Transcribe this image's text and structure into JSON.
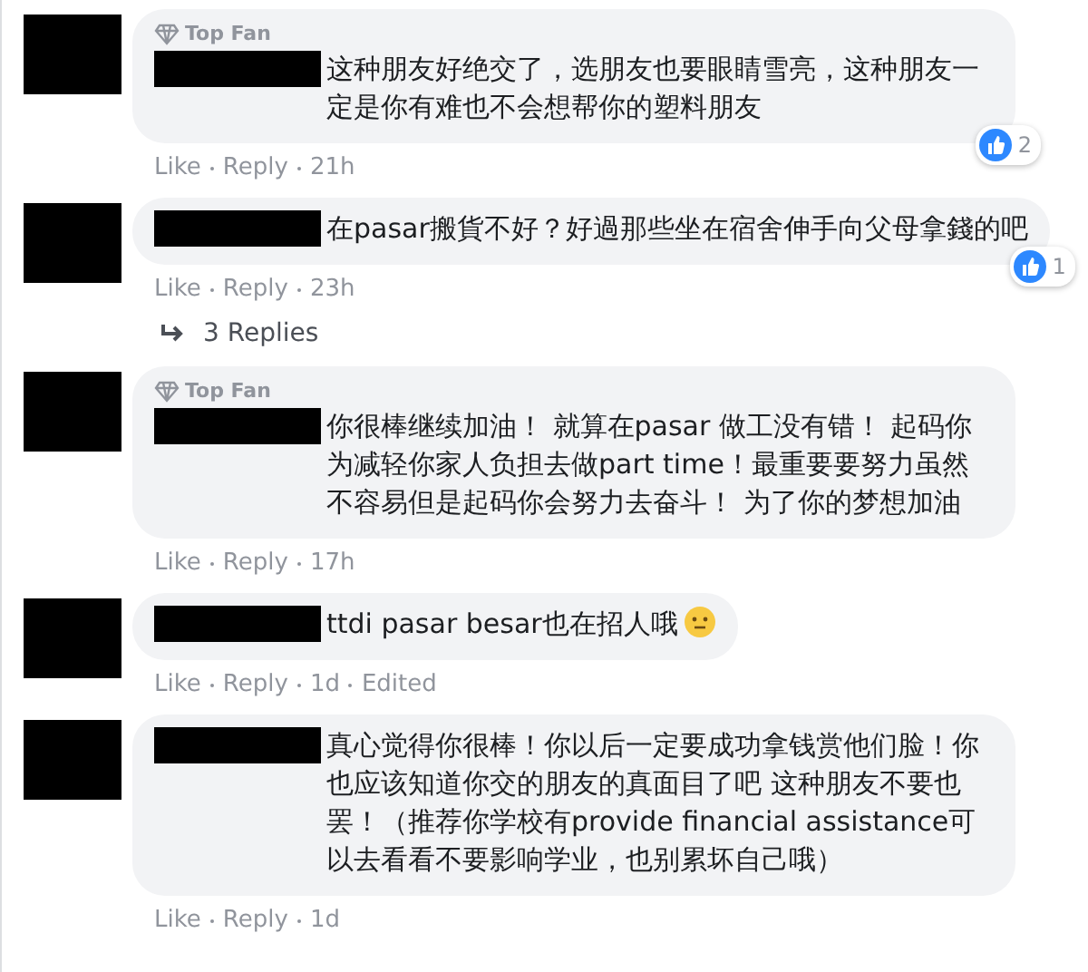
{
  "items": [
    {
      "kind": "comment",
      "badge": "Top Fan",
      "text": "这种朋友好绝交了，选朋友也要眼睛雪亮，这种朋友一定是你有难也不会想帮你的塑料朋友",
      "reactions": "2",
      "actions": [
        "Like",
        "Reply"
      ],
      "time": "21h"
    },
    {
      "kind": "comment",
      "text": "在pasar搬貨不好？好過那些坐在宿舍伸手向父母拿錢的吧",
      "reactions": "1",
      "actions": [
        "Like",
        "Reply"
      ],
      "time": "23h"
    },
    {
      "kind": "replies",
      "label": "3 Replies"
    },
    {
      "kind": "comment",
      "badge": "Top Fan",
      "text": "你很棒继续加油！ 就算在pasar 做工没有错！ 起码你为减轻你家人负担去做part time！最重要要努力虽然不容易但是起码你会努力去奋斗！ 为了你的梦想加油",
      "actions": [
        "Like",
        "Reply"
      ],
      "time": "17h"
    },
    {
      "kind": "comment",
      "text": "ttdi pasar besar也在招人哦",
      "emoji": true,
      "actions": [
        "Like",
        "Reply"
      ],
      "time": "1d",
      "edited": "Edited"
    },
    {
      "kind": "comment",
      "text": "真心觉得你很棒！你以后一定要成功拿钱赏他们脸！你也应该知道你交的朋友的真面目了吧 这种朋友不要也罢！（推荐你学校有provide financial assistance可以去看看不要影响学业，也别累坏自己哦）",
      "actions": [
        "Like",
        "Reply"
      ],
      "time": "1d"
    }
  ]
}
